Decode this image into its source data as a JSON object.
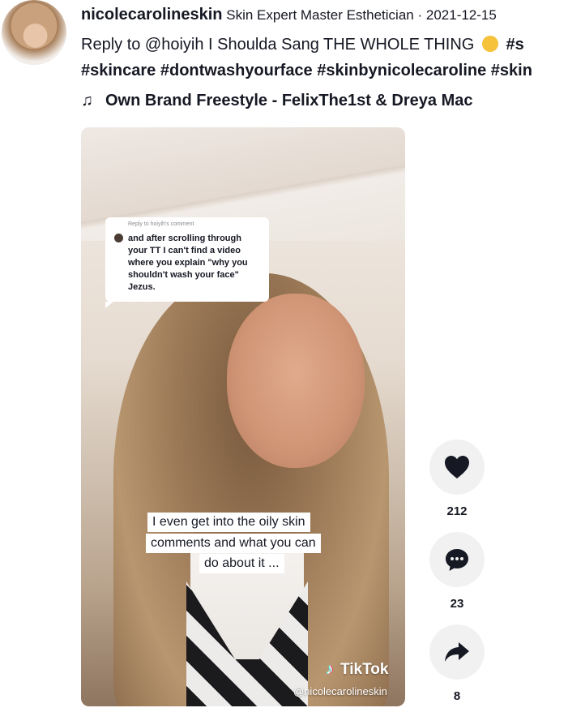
{
  "author": {
    "username": "nicolecarolineskin",
    "nickname": "Skin Expert Master Esthetician",
    "separator": "·",
    "date": "2021-12-15"
  },
  "description": {
    "line1_text": "Reply to @hoiyih I Shoulda Sang THE WHOLE THING",
    "line1_tail_hashtag": "#s",
    "hashtags_line2": [
      "#skincare",
      "#dontwashyourface",
      "#skinbynicolecaroline",
      "#skin"
    ]
  },
  "music": {
    "icon": "music-note-icon",
    "title": "Own Brand Freestyle - FelixThe1st & Dreya Mac"
  },
  "video": {
    "reply_card": {
      "label": "Reply to hoiyih's comment",
      "text": "and after scrolling through\nyour TT I can't find a video\nwhere you explain \"why you\nshouldn't wash your face\"\nJezus."
    },
    "caption_lines": [
      "I even get into the oily skin",
      "comments and what you can",
      "do about it ..."
    ],
    "logo_text": "TikTok",
    "watermark": "@nicolecarolineskin"
  },
  "actions": {
    "likes": "212",
    "comments": "23",
    "shares": "8"
  },
  "colors": {
    "text": "#161823",
    "action_bg": "#f1f1f2",
    "tiktok_cyan": "#25f4ee",
    "tiktok_red": "#fe2c55"
  }
}
